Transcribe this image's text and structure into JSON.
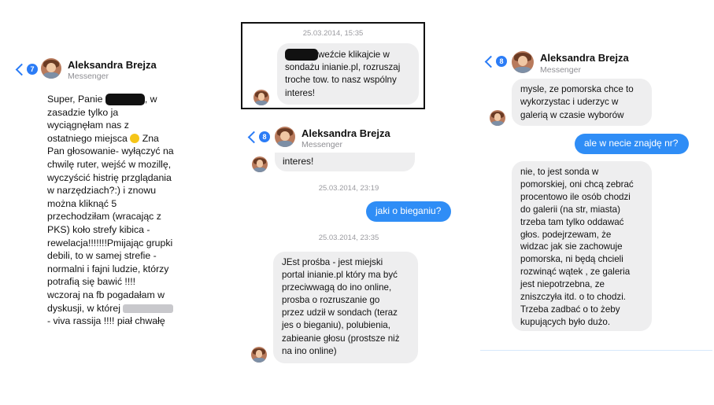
{
  "panel1": {
    "header": {
      "badge": "7",
      "name": "Aleksandra Brejza",
      "subtitle": "Messenger"
    },
    "lines": [
      "Super, Panie",
      "zasadzie tylko ja",
      "wyciągnęłam nas z",
      "ostatniego miejsca",
      "Pan głosowanie- wyłączyć na",
      "chwilę ruter, wejść w mozillę,",
      "wyczyścić histrię przglądania",
      "w narzędziach?:) i znowu",
      "można kliknąć 5",
      "  przechodziłam  (wracając z",
      "PKS) koło strefy kibica -",
      "rewelacja!!!!!!!Pmijając grupki",
      "debili, to w samej strefie -",
      "normalni i fajni ludzie, którzy",
      "potrafią się bawić !!!!",
      "wczoraj na fb pogadałam w",
      "dyskusji, w której",
      "- viva rassija !!!! piał chwałę"
    ],
    "line1_tail": ", w",
    "line4_tail": "Zna"
  },
  "panel2": {
    "timestamp": "25.03.2014, 15:35",
    "lines": [
      "weźcie klikajcie w",
      "sondażu inianie.pl, rozruszaj",
      "troche tow.  to nasz wspólny",
      "interes!"
    ]
  },
  "panel3": {
    "header": {
      "badge": "8",
      "name": "Aleksandra Brejza",
      "subtitle": "Messenger"
    },
    "partial_bubble": "interes!",
    "timestamp1": "25.03.2014, 23:19",
    "my_message": "jaki o bieganiu?",
    "timestamp2": "25.03.2014, 23:35",
    "lines": [
      "JEst prośba - jest miejski",
      "portal inianie.pl który ma być",
      "przeciwwagą do  ino online,",
      "prosba o rozruszanie go",
      "przez udził w sondach (teraz",
      "jes o bieganiu), polubienia,",
      "zabieanie głosu (prostsze niż",
      "na ino online)"
    ]
  },
  "panel4": {
    "header": {
      "badge": "8",
      "name": "Aleksandra Brejza",
      "subtitle": "Messenger"
    },
    "bubble1": [
      "mysle, ze pomorska chce to",
      "wykorzystac i uderzyc w",
      "galerią w czasie wyborów"
    ],
    "my_message": "ale w necie znajdę nr?",
    "bubble2": [
      "nie, to jest sonda w",
      "pomorskiej, oni chcą zebrać",
      "procentowo ile osób chodzi",
      "do galerii (na str, miasta)",
      "trzeba tam tylko oddawać",
      "głos. podejrzewam, że",
      "widzac jak sie zachowuje",
      "pomorska, ni będą chcieli",
      "rozwinąć wątek , ze galeria",
      "jest niepotrzebna, ze",
      "zniszczyła itd. o to chodzi.",
      "Trzeba zadbać o to żeby",
      "kupujących było dużo."
    ]
  },
  "colors": {
    "accent": "#2b7cf6",
    "my_bubble": "#2f8df6",
    "their_bubble": "#eeeeef"
  },
  "icons": [
    "back-chevron-icon",
    "avatar",
    "smiley-emoji-icon"
  ]
}
